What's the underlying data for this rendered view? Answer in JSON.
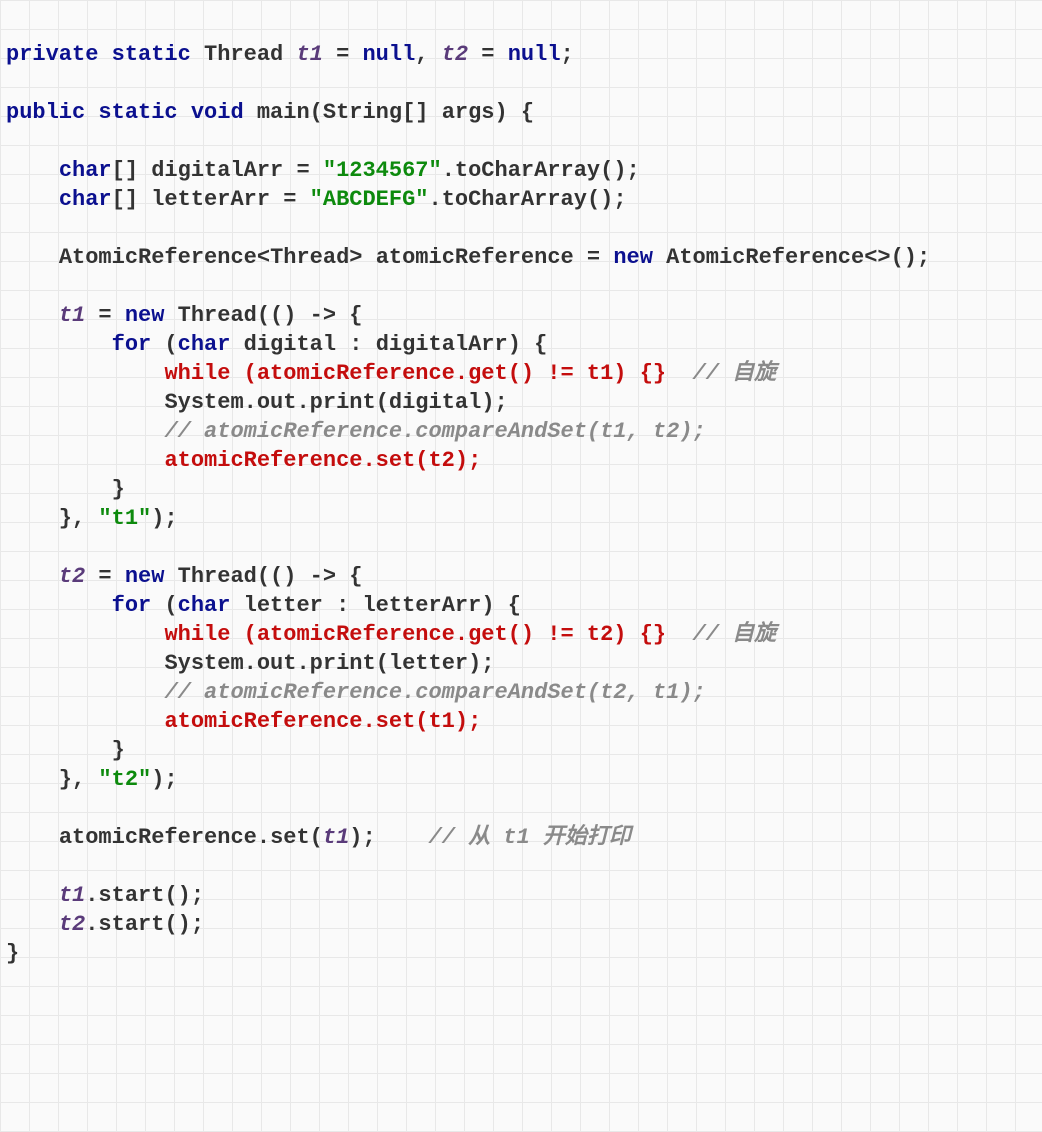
{
  "kw": {
    "private": "private",
    "static": "static",
    "public": "public",
    "void": "void",
    "null": "null",
    "char": "char",
    "new": "new",
    "for": "for",
    "while": "while"
  },
  "ident": {
    "Thread": "Thread",
    "t1": "t1",
    "t2": "t2",
    "main": "main",
    "String": "String",
    "args": "args",
    "digitalArr": "digitalArr",
    "letterArr": "letterArr",
    "AtomicReference": "AtomicReference",
    "atomicReference": "atomicReference",
    "digital": "digital",
    "letter": "letter",
    "System": "System",
    "out": "out",
    "print": "print",
    "toCharArray": "toCharArray",
    "get": "get",
    "set": "set",
    "start": "start"
  },
  "str": {
    "digits": "\"1234567\"",
    "letters": "\"ABCDEFG\"",
    "t1": "\"t1\"",
    "t2": "\"t2\""
  },
  "cmt": {
    "spin": "// 自旋",
    "cas12": "// atomicReference.compareAndSet(t1, t2);",
    "cas21": "// atomicReference.compareAndSet(t2, t1);",
    "start": "// 从 t1 开始打印"
  },
  "stmt": {
    "while1": "while (atomicReference.get() != t1) {}",
    "set_t2": "atomicReference.set(t2);",
    "while2": "while (atomicReference.get() != t2) {}",
    "set_t1": "atomicReference.set(t1);"
  }
}
